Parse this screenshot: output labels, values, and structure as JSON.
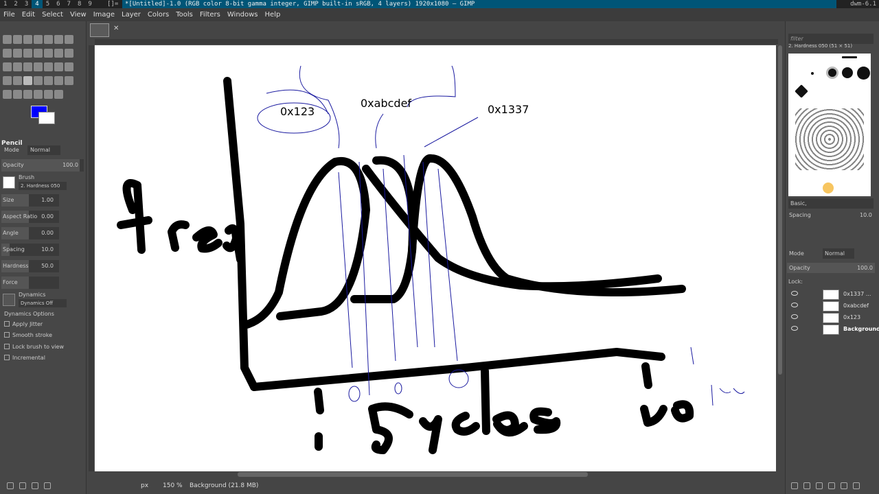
{
  "dwm": {
    "tags": [
      "1",
      "2",
      "3",
      "4",
      "5",
      "6",
      "7",
      "8",
      "9"
    ],
    "selected_tag": "4",
    "layout_symbol": "[]=",
    "window_title": "*[Untitled]-1.0 (RGB color 8-bit gamma integer, GIMP built-in sRGB, 4 layers) 1920x1080 – GIMP",
    "status": "dwm-6.1"
  },
  "menubar": [
    "File",
    "Edit",
    "Select",
    "View",
    "Image",
    "Layer",
    "Colors",
    "Tools",
    "Filters",
    "Windows",
    "Help"
  ],
  "toolbox": {
    "foreground_color": "#0000ff",
    "background_color": "#ffffff",
    "tool_name": "Pencil",
    "mode_label": "Mode",
    "mode_value": "Normal",
    "options": [
      {
        "label": "Opacity",
        "value": "100.0"
      },
      {
        "label": "Size",
        "value": "1.00"
      },
      {
        "label": "Aspect Ratio",
        "value": "0.00"
      },
      {
        "label": "Angle",
        "value": "0.00"
      },
      {
        "label": "Spacing",
        "value": "10.0"
      },
      {
        "label": "Hardness",
        "value": "50.0"
      },
      {
        "label": "Force",
        "value": ""
      }
    ],
    "brush_label": "Brush",
    "brush_value": "2. Hardness 050",
    "dynamics_label": "Dynamics",
    "dynamics_value": "Dynamics Off",
    "dynamics_options": "Dynamics Options",
    "checkboxes": [
      "Apply Jitter",
      "Smooth stroke",
      "Lock brush to view",
      "Incremental"
    ]
  },
  "canvas_text": {
    "label1": "0x123",
    "label2": "0xabcdef",
    "label3": "0x1337"
  },
  "statusbar": {
    "unit": "px",
    "zoom": "150 %",
    "layer_info": "Background (21.8 MB)"
  },
  "right_panel": {
    "filter_placeholder": "filter",
    "brush_name": "2. Hardness 050 (51 × 51)",
    "preset": "Basic,",
    "spacing_label": "Spacing",
    "spacing_value": "10.0",
    "mode_label": "Mode",
    "mode_value": "Normal",
    "opacity_label": "Opacity",
    "opacity_value": "100.0",
    "lock_label": "Lock:",
    "layers": [
      "0x1337 ...",
      "0xabcdef",
      "0x123",
      "Background"
    ],
    "selected_layer": "Background"
  },
  "colors": {
    "dwm_accent": "#005577",
    "ink": "#000000",
    "pen_blue": "#1a1aa0"
  }
}
